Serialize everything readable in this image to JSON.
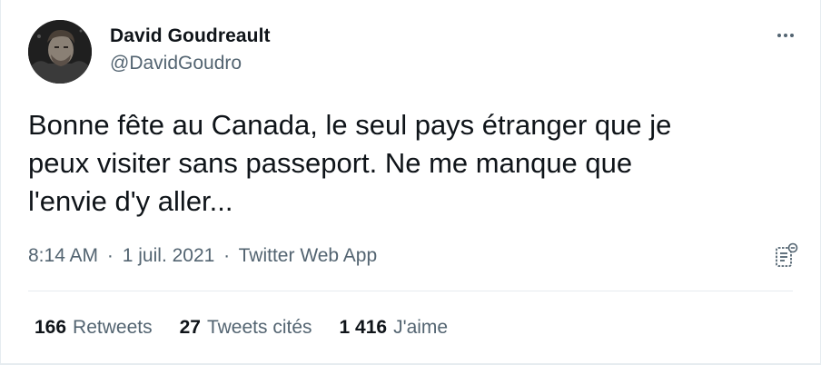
{
  "author": {
    "name": "David Goudreault",
    "handle": "@DavidGoudro"
  },
  "tweet": {
    "text": "Bonne fête au Canada, le seul pays étranger que je\npeux visiter sans passeport. Ne me manque que\nl'envie d'y aller...",
    "time": "8:14 AM",
    "date": "1 juil. 2021",
    "source": "Twitter Web App",
    "separator": "·"
  },
  "stats": {
    "retweets": {
      "count": "166",
      "label": "Retweets"
    },
    "quotes": {
      "count": "27",
      "label": "Tweets cités"
    },
    "likes": {
      "count": "1 416",
      "label": "J'aime"
    }
  },
  "icons": {
    "more": "more-horizontal-icon",
    "analytics": "analytics-icon"
  },
  "colors": {
    "text_primary": "#0f1419",
    "text_secondary": "#536471",
    "divider": "#e6ecf0"
  }
}
